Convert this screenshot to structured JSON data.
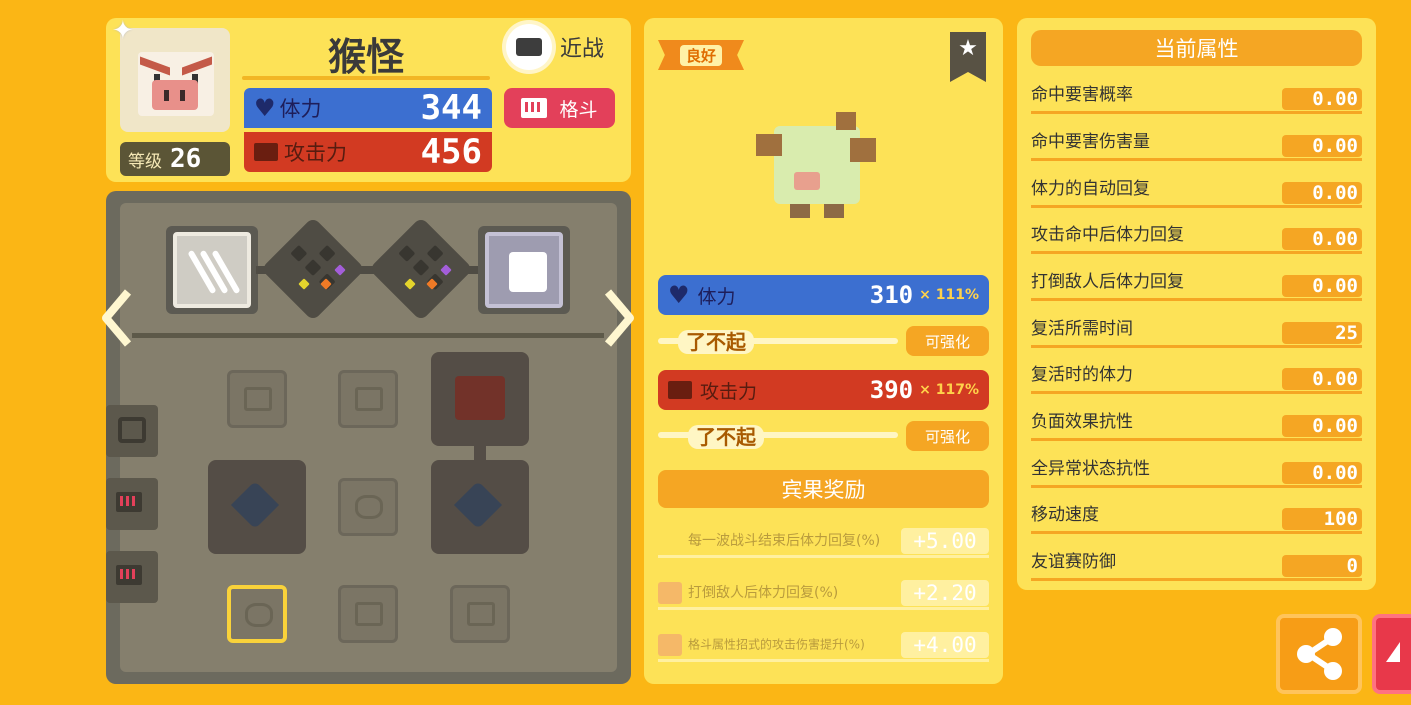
{
  "pokemon": {
    "name": "猴怪",
    "level_label": "等级",
    "level": "26",
    "attack_style": "近战",
    "type": "格斗",
    "hp_label": "体力",
    "hp": "344",
    "atk_label": "攻击力",
    "atk": "456"
  },
  "detail": {
    "quality": "良好",
    "hp_label": "体力",
    "hp": "310",
    "hp_mult": "× 111%",
    "hp_rating": "了不起",
    "atk_label": "攻击力",
    "atk": "390",
    "atk_mult": "× 117%",
    "atk_rating": "了不起",
    "upgrade_label": "可强化",
    "bonus_title": "宾果奖励",
    "bonuses": [
      {
        "label": "每一波战斗结束后体力回复(%)",
        "value": "+5.00"
      },
      {
        "label": "打倒敌人后体力回复(%)",
        "value": "+2.20"
      },
      {
        "label": "格斗属性招式的攻击伤害提升(%)",
        "value": "+4.00"
      }
    ]
  },
  "attributes": {
    "title": "当前属性",
    "items": [
      {
        "label": "命中要害概率",
        "value": "0.00"
      },
      {
        "label": "命中要害伤害量",
        "value": "0.00"
      },
      {
        "label": "体力的自动回复",
        "value": "0.00"
      },
      {
        "label": "攻击命中后体力回复",
        "value": "0.00"
      },
      {
        "label": "打倒敌人后体力回复",
        "value": "0.00"
      },
      {
        "label": "复活所需时间",
        "value": "25"
      },
      {
        "label": "复活时的体力",
        "value": "0.00"
      },
      {
        "label": "负面效果抗性",
        "value": "0.00"
      },
      {
        "label": "全异常状态抗性",
        "value": "0.00"
      },
      {
        "label": "移动速度",
        "value": "100"
      },
      {
        "label": "友谊赛防御",
        "value": "0"
      }
    ]
  },
  "colors": {
    "background": "#fbb615",
    "hp": "#3c6fd0",
    "attack": "#d23a22",
    "accent": "#f5a623",
    "type_fighting": "#e3405a"
  }
}
